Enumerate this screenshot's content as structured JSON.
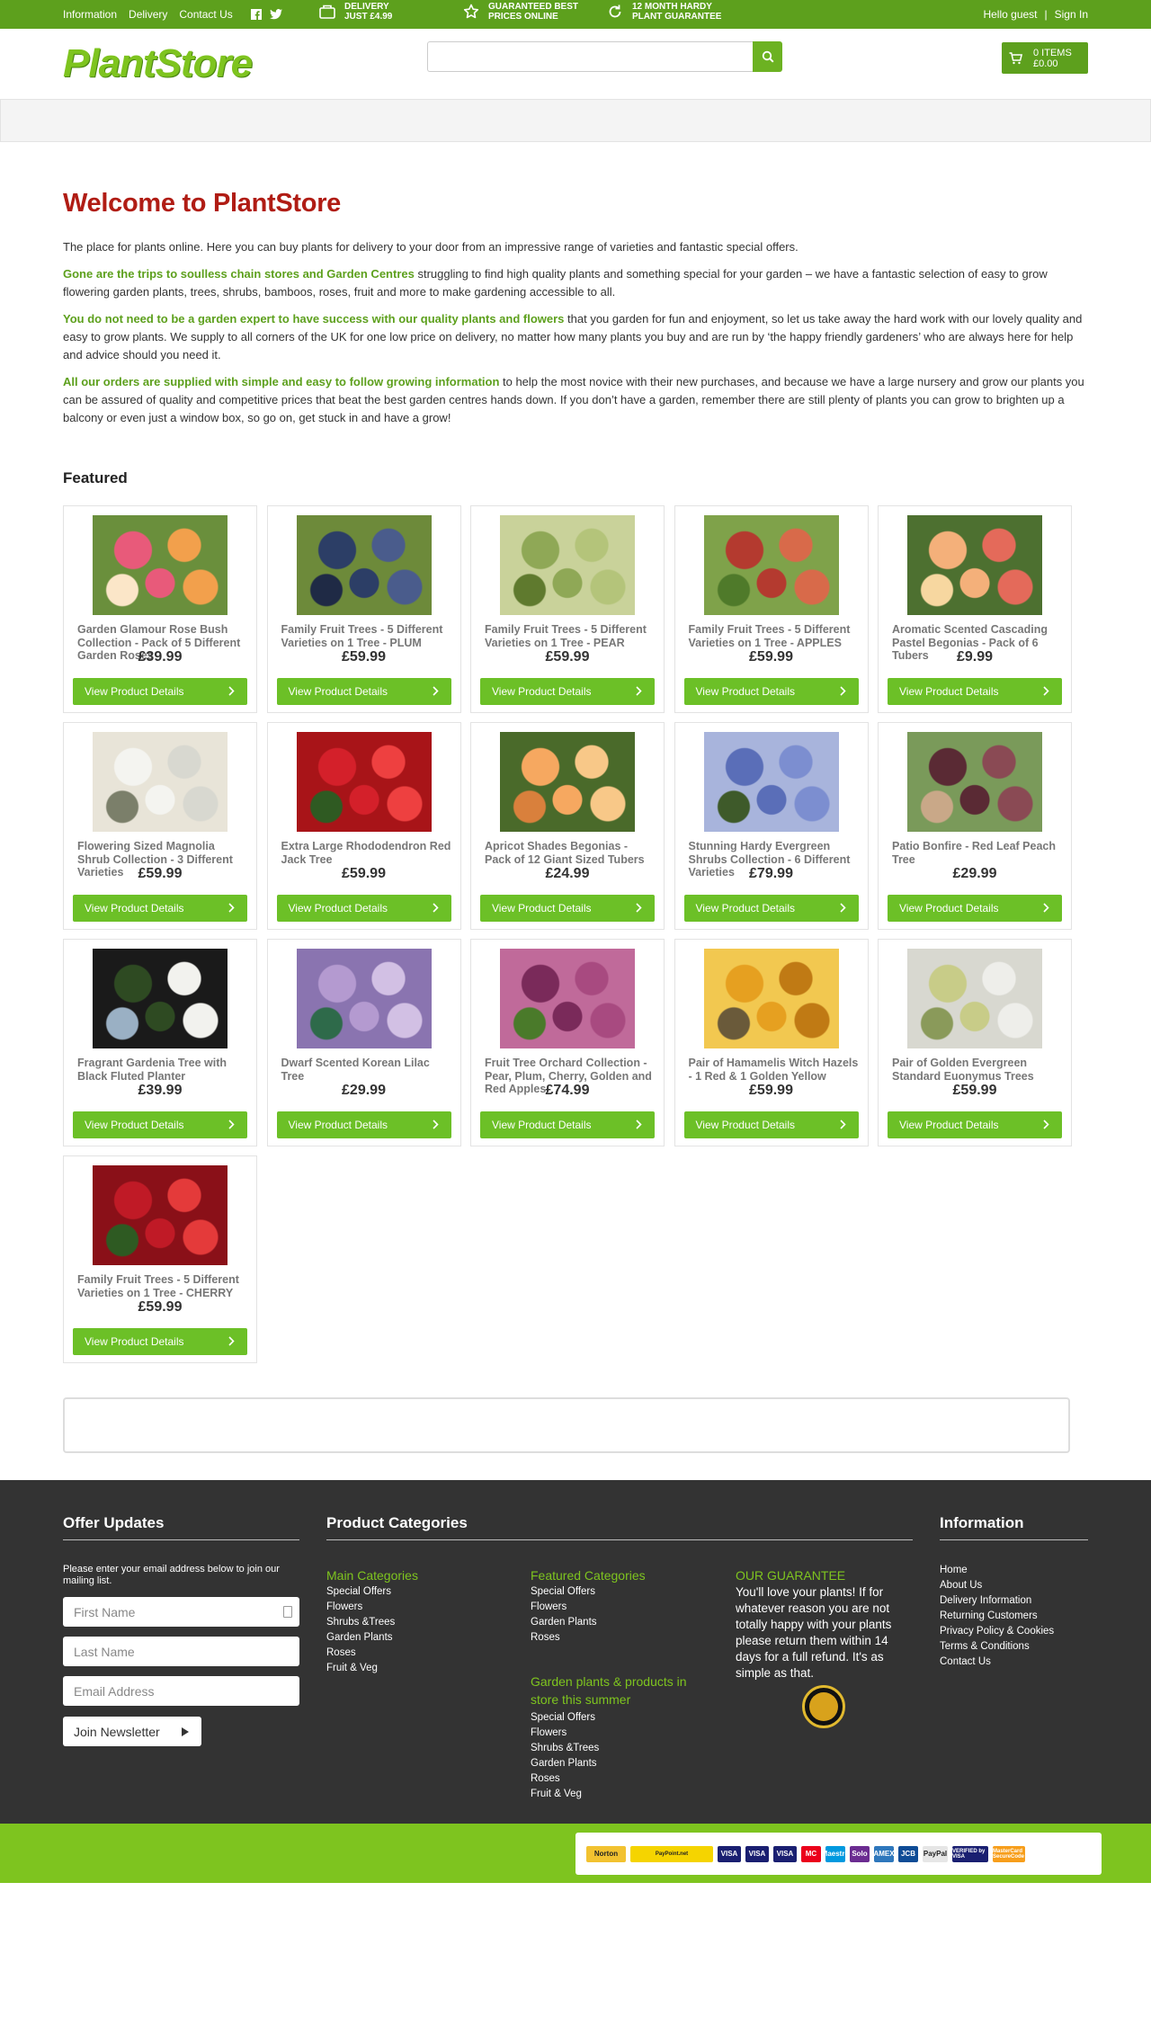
{
  "topbar": {
    "links": [
      "Information",
      "Delivery",
      "Contact Us"
    ],
    "usps": [
      {
        "line1": "DELIVERY",
        "line2": "JUST £4.99"
      },
      {
        "line1": "GUARANTEED BEST",
        "line2": "PRICES ONLINE"
      },
      {
        "line1": "12 MONTH HARDY",
        "line2": "PLANT GUARANTEE"
      }
    ],
    "greeting": "Hello guest",
    "sign_in": "Sign In"
  },
  "header": {
    "logo": "PlantStore",
    "search_placeholder": "",
    "cart_items": "0 ITEMS",
    "cart_total": "£0.00"
  },
  "intro": {
    "title": "Welcome to PlantStore",
    "p1": "The place for plants online. Here you can buy plants for delivery to your door from an impressive range of varieties and fantastic special offers.",
    "p2_bold": "Gone are the trips to soulless chain stores and Garden Centres",
    "p2_rest": " struggling to find high quality plants and something special for your garden – we have a fantastic selection of easy to grow flowering garden plants, trees, shrubs, bamboos, roses, fruit and more to make gardening accessible to all.",
    "p3_bold": "You do not need to be a garden expert to have success with our quality plants and flowers",
    "p3_rest": " that you garden for fun and enjoyment, so let us take away the hard work with our lovely quality and easy to grow plants. We supply to all corners of the UK for one low price on delivery, no matter how many plants you buy and are run by ‘the happy friendly gardeners’ who are always here for help and advice should you need it.",
    "p4_bold": "All our orders are supplied with simple and easy to follow growing information",
    "p4_rest": " to help the most novice with their new purchases, and because we have a large nursery and grow our plants you can be assured of quality and competitive prices that beat the best garden centres hands down. If you don’t have a garden, remember there are still plenty of plants you can grow to brighten up a balcony or even just a window box, so go on, get stuck in and have a grow!"
  },
  "featured": {
    "title": "Featured",
    "button_label": "View  Product Details",
    "products": [
      {
        "name": "Garden Glamour Rose Bush Collection - Pack of 5 Different Garden Roses",
        "price": "£39.99",
        "colors": [
          "#e85a7a",
          "#f2a04c",
          "#fbe6c8",
          "#6a8f3c"
        ]
      },
      {
        "name": "Family Fruit Trees - 5 Different Varieties on 1 Tree - PLUM",
        "price": "£59.99",
        "colors": [
          "#2c3e66",
          "#4a5c8c",
          "#1f2a45",
          "#6d8a3a"
        ]
      },
      {
        "name": "Family Fruit Trees - 5 Different Varieties on 1 Tree - PEAR",
        "price": "£59.99",
        "colors": [
          "#8fa856",
          "#b4c47a",
          "#5f7a2e",
          "#c9d29a"
        ]
      },
      {
        "name": "Family Fruit Trees - 5 Different Varieties on 1 Tree - APPLES",
        "price": "£59.99",
        "colors": [
          "#b43a2f",
          "#d86a4a",
          "#4f7a2a",
          "#7fa24a"
        ]
      },
      {
        "name": "Aromatic Scented Cascading Pastel Begonias - Pack of 6 Tubers",
        "price": "£9.99",
        "colors": [
          "#f4b07a",
          "#e46a5a",
          "#f7d7a0",
          "#4d7030"
        ]
      },
      {
        "name": "Flowering Sized Magnolia Shrub Collection - 3 Different Varieties",
        "price": "£59.99",
        "colors": [
          "#f4f4f0",
          "#d8d8d0",
          "#7b7f6a",
          "#e8e4d8"
        ]
      },
      {
        "name": "Extra Large Rhododendron Red Jack Tree",
        "price": "£59.99",
        "colors": [
          "#d4202a",
          "#ee4040",
          "#2f5a22",
          "#a81418"
        ]
      },
      {
        "name": "Apricot Shades Begonias - Pack of 12 Giant Sized Tubers",
        "price": "£24.99",
        "colors": [
          "#f6a860",
          "#f8c888",
          "#d9803c",
          "#4a6a2a"
        ]
      },
      {
        "name": "Stunning Hardy Evergreen Shrubs Collection - 6 Different Varieties",
        "price": "£79.99",
        "colors": [
          "#5a6eb8",
          "#7c8ed0",
          "#3e5a2a",
          "#a8b4dc"
        ]
      },
      {
        "name": "Patio Bonfire - Red Leaf Peach Tree",
        "price": "£29.99",
        "colors": [
          "#5a2a34",
          "#8a4a54",
          "#c9a888",
          "#7a9a5a"
        ]
      },
      {
        "name": "Fragrant Gardenia Tree with Black Fluted Planter",
        "price": "£39.99",
        "colors": [
          "#2e4a22",
          "#f2f2ee",
          "#9ab0c4",
          "#1a1a1a"
        ]
      },
      {
        "name": "Dwarf Scented Korean Lilac Tree",
        "price": "£29.99",
        "colors": [
          "#b49ad0",
          "#d2c0e4",
          "#2e6a4a",
          "#8a74b0"
        ]
      },
      {
        "name": "Fruit Tree Orchard Collection - Pear, Plum, Cherry, Golden and Red Apples",
        "price": "£74.99",
        "colors": [
          "#7a2a5a",
          "#a84a80",
          "#4a7a2a",
          "#c06a9a"
        ]
      },
      {
        "name": "Pair of Hamamelis Witch Hazels - 1 Red & 1 Golden Yellow",
        "price": "£59.99",
        "colors": [
          "#e6a020",
          "#c07a14",
          "#6a5a3a",
          "#f2c850"
        ]
      },
      {
        "name": "Pair of Golden Evergreen Standard Euonymus Trees",
        "price": "£59.99",
        "colors": [
          "#c8cc88",
          "#eeeeea",
          "#8a9a5a",
          "#d8d8d0"
        ]
      },
      {
        "name": "Family Fruit Trees - 5 Different Varieties on 1 Tree - CHERRY",
        "price": "£59.99",
        "colors": [
          "#c01a26",
          "#e43a3a",
          "#2e5a22",
          "#8a1018"
        ]
      }
    ]
  },
  "footer": {
    "offer": {
      "title": "Offer Updates",
      "desc": "Please enter your email address below to join our mailing list.",
      "first_name": "First Name",
      "last_name": "Last Name",
      "email": "Email Address",
      "join": "Join Newsletter"
    },
    "categories": {
      "title": "Product Categories",
      "main": {
        "heading": "Main Categories",
        "items": [
          "Special Offers",
          "Flowers",
          "Shrubs &Trees",
          "Garden Plants",
          "Roses",
          "Fruit & Veg"
        ]
      },
      "featured": {
        "heading": "Featured Categories",
        "items": [
          "Special Offers",
          "Flowers",
          "Garden Plants",
          "Roses"
        ]
      },
      "summer": {
        "heading": "Garden plants & products in store this summer",
        "items": [
          "Special Offers",
          "Flowers",
          "Shrubs &Trees",
          "Garden Plants",
          "Roses",
          "Fruit & Veg"
        ]
      },
      "guarantee": {
        "heading": "OUR GUARANTEE",
        "text": "You'll love your plants! If for whatever reason you are not totally happy with your plants please return them within 14 days for a full refund. It's as simple as that."
      }
    },
    "information": {
      "title": "Information",
      "items": [
        "Home",
        "About Us",
        "Delivery Information",
        "Returning Customers",
        "Privacy Policy & Cookies",
        "Terms & Conditions",
        "Contact Us"
      ]
    },
    "payments": [
      "Norton",
      "PayPoint.net",
      "VISA",
      "VISA",
      "VISA",
      "MC",
      "Maestro",
      "Solo",
      "AMEX",
      "JCB",
      "PayPal",
      "VERIFIED by VISA",
      "MasterCard SecureCode"
    ]
  },
  "colors": {
    "brand_green": "#5da01d",
    "accent_green": "#6cc027",
    "title_red": "#b01c14",
    "footer_bg": "#333333"
  }
}
